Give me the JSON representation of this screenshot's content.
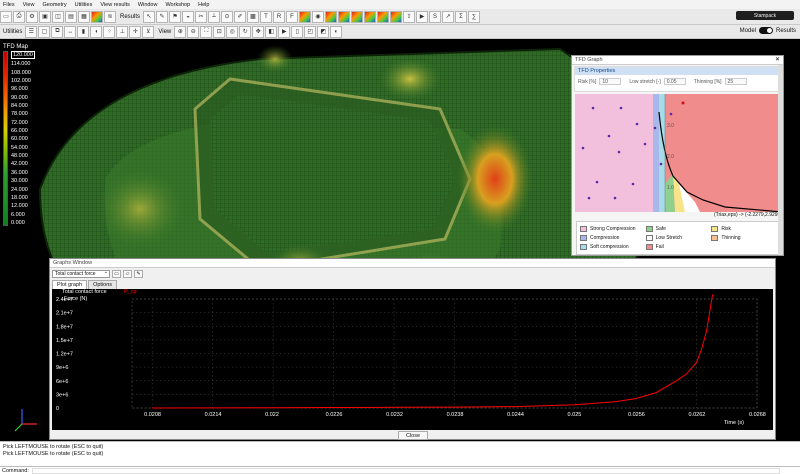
{
  "menu": [
    "Files",
    "View",
    "Geometry",
    "Utilities",
    "View results",
    "Window",
    "Workshop",
    "Help"
  ],
  "toolbar": {
    "results_label": "Results",
    "utilities_label": "Utilities",
    "view_label": "View"
  },
  "brand": "Stampack",
  "model_toggle": {
    "label_model": "Model",
    "label_results": "Results",
    "state": "results"
  },
  "legend": {
    "title": "TFD Map",
    "values": [
      "120.000",
      "114.000",
      "108.000",
      "102.000",
      "96.000",
      "90.000",
      "84.000",
      "78.000",
      "72.000",
      "66.000",
      "60.000",
      "54.000",
      "48.000",
      "42.000",
      "36.000",
      "30.000",
      "24.000",
      "18.000",
      "12.000",
      "6.000",
      "0.000"
    ]
  },
  "tfd": {
    "title": "TFD Graph",
    "properties_title": "TFD Properties",
    "risk_label": "Risk [%]",
    "risk_value": "10",
    "low_stretch_label": "Low stretch [-]",
    "low_stretch_value": "0.05",
    "thinning_label": "Thinning [%]",
    "thinning_value": "25",
    "coord": "(Triax,eps) -> (-2.2279,2.9295)",
    "axis_ticks": [
      "3.0",
      "2.0",
      "1.0"
    ],
    "legend_items": [
      {
        "label": "Strong Compression",
        "color": "#f2c0dc"
      },
      {
        "label": "Safe",
        "color": "#8fd08f"
      },
      {
        "label": "Risk",
        "color": "#f6e38a"
      },
      {
        "label": "Compression",
        "color": "#a9b8ea"
      },
      {
        "label": "Low Stretch",
        "color": "#ffffff"
      },
      {
        "label": "Thinning",
        "color": "#f6c090"
      },
      {
        "label": "Soft compression",
        "color": "#a6dbe8"
      },
      {
        "label": "Fail",
        "color": "#f08c8c"
      }
    ]
  },
  "graphs": {
    "title": "Graphs Window",
    "dropdown_value": "Total contact force",
    "tabs": [
      "Plot graph",
      "Options"
    ],
    "active_tab": "Plot graph",
    "close_label": "Close"
  },
  "console": [
    "Pick LEFTMOUSE to rotate (ESC to quit)",
    "Pick LEFTMOUSE to rotate (ESC to quit)"
  ],
  "command_label": "Command:",
  "chart_data": {
    "type": "line",
    "title": "Total contact force",
    "series": [
      {
        "name": "P_cp",
        "color": "#ff0000",
        "x": [
          0.0208,
          0.0214,
          0.022,
          0.0226,
          0.0232,
          0.0238,
          0.0244,
          0.025,
          0.0254,
          0.0256,
          0.0258,
          0.026,
          0.0261,
          0.0262,
          0.02625,
          0.0263,
          0.02633,
          0.02636
        ],
        "y": [
          0,
          20000,
          60000,
          100000,
          150000,
          200000,
          300000,
          700000,
          1400000,
          2100000,
          3400000,
          6000000,
          7500000,
          10000000,
          13000000,
          17000000,
          21000000,
          25000000
        ]
      }
    ],
    "ylabel": "Force (N)",
    "xlabel": "Time (s)",
    "x_ticks": [
      "0.0208",
      "0.0214",
      "0.022",
      "0.0226",
      "0.0232",
      "0.0238",
      "0.0244",
      "0.025",
      "0.0256",
      "0.0262",
      "0.0268"
    ],
    "y_ticks": [
      "2.4e+7",
      "2.1e+7",
      "1.8e+7",
      "1.5e+7",
      "1.2e+7",
      "9e+6",
      "6e+6",
      "3e+6",
      "0"
    ],
    "xlim": [
      0.0206,
      0.0268
    ],
    "ylim": [
      0,
      24000000
    ],
    "grid": true,
    "legend": "top-left"
  }
}
